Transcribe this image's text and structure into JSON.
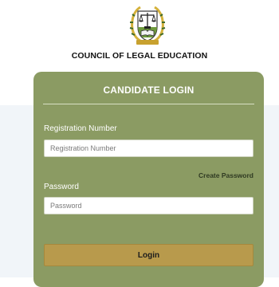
{
  "header": {
    "org_name": "COUNCIL OF LEGAL EDUCATION",
    "logo_icon": "scales-of-justice-crest-icon"
  },
  "login": {
    "title": "CANDIDATE LOGIN",
    "registration_label": "Registration Number",
    "registration_placeholder": "Registration Number",
    "create_password_link": "Create Password",
    "password_label": "Password",
    "password_placeholder": "Password",
    "submit_label": "Login"
  },
  "colors": {
    "card": "#8b9b63",
    "button": "#b89a4c",
    "background_band": "#f1f5f9"
  }
}
